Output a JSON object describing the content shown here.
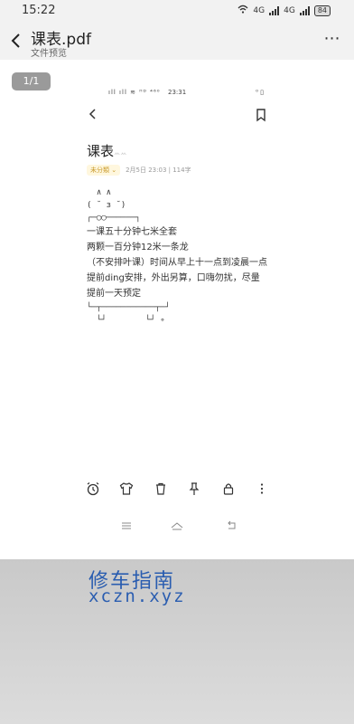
{
  "status_bar": {
    "time": "15:22",
    "network": "4G",
    "network2": "4G",
    "battery": "84"
  },
  "app_bar": {
    "title": "课表.pdf",
    "subtitle": "文件预览"
  },
  "page_indicator": "1/1",
  "note": {
    "status_bar": {
      "time": "23:31",
      "left_icons": "ıll ıll ≋ ᵸᴰ ⁴⁶⁰",
      "right_icons": "⁰ ▯"
    },
    "title": "课表",
    "category": "未分類",
    "meta": "2月5日 23:03 | 114字",
    "ascii_lines": [
      "  ∧ ∧",
      "( ˘ з ˘)",
      "┌─◯◯──────┐"
    ],
    "lines": [
      "一课五十分钟七米全套",
      "两颗一百分钟12米一条龙",
      "（不安排叶课）时间从早上十一点到凌晨一点",
      "提前ding安排，外出另算，口嗨勿扰，尽量",
      "提前一天预定"
    ],
    "ascii_footer": [
      "└─┬───────────┬─┘",
      "  └┘        └┘ ∘"
    ]
  },
  "watermark": {
    "line1": "修车指南",
    "line2": "xczn.xyz"
  },
  "colors": {
    "accent_watermark": "#2a5db0",
    "category_bg": "#fff7de",
    "category_text": "#c99a2a"
  },
  "icons": [
    "back-arrow-icon",
    "more-icon",
    "bookmark-icon",
    "alarm-icon",
    "shirt-icon",
    "trash-icon",
    "pin-icon",
    "lock-icon",
    "menu-icon",
    "home-icon",
    "return-icon"
  ]
}
